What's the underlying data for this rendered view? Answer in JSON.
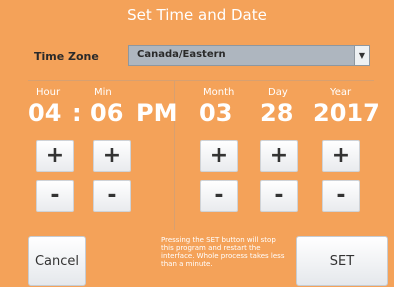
{
  "title": "Set Time and Date",
  "time_zone": {
    "label": "Time Zone",
    "value": "Canada/Eastern"
  },
  "columns": {
    "hour_label": "Hour",
    "min_label": "Min",
    "month_label": "Month",
    "day_label": "Day",
    "year_label": "Year"
  },
  "values": {
    "hour": "04",
    "sep": ":",
    "min": "06",
    "ampm": "PM",
    "month": "03",
    "day": "28",
    "year": "2017"
  },
  "plus_label": "+",
  "minus_label": "-",
  "buttons": {
    "cancel": "Cancel",
    "set": "SET"
  },
  "note": "Pressing the SET button will stop this program and restart the interface. Whole process takes less than a minute.",
  "colors": {
    "background": "#f4a259",
    "select": "#aeb6bf",
    "button": "#ffffff"
  },
  "icons": {
    "dropdown": "chevron-down-icon"
  }
}
